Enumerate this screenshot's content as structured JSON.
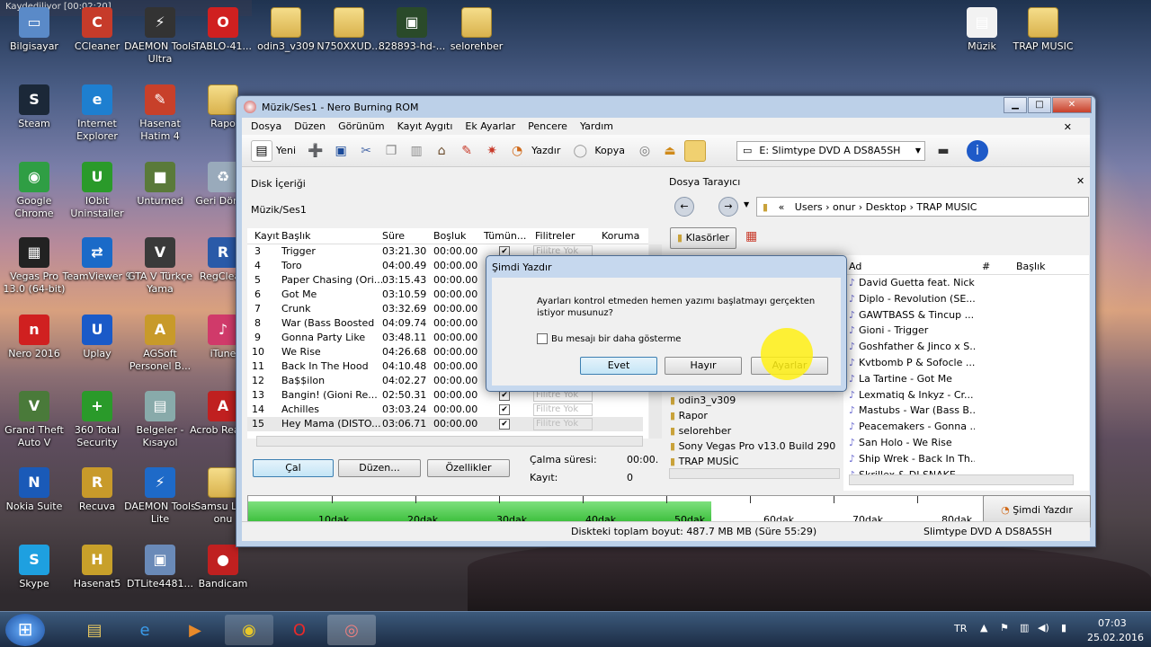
{
  "recording_label": "Kaydediliyor [00:02:20]",
  "desktop_icons": [
    {
      "label": "Bilgisayar",
      "glyph": "▭",
      "color": "#5a8ac8"
    },
    {
      "label": "CCleaner",
      "glyph": "C",
      "color": "#c63b2a"
    },
    {
      "label": "DAEMON Tools Ultra",
      "glyph": "⚡",
      "color": "#333"
    },
    {
      "label": "TABLO-41...",
      "glyph": "O",
      "color": "#d02020"
    },
    {
      "label": "odin3_v309",
      "glyph": "",
      "color": ""
    },
    {
      "label": "N750XXUD...",
      "glyph": "",
      "color": ""
    },
    {
      "label": "828893-hd-...",
      "glyph": "▣",
      "color": "#2a4a2a"
    },
    {
      "label": "selorehber",
      "glyph": "",
      "color": ""
    },
    {
      "label": "Müzik",
      "glyph": "▤",
      "color": "#f2f2f2"
    },
    {
      "label": "TRAP MUSIC",
      "glyph": "",
      "color": ""
    },
    {
      "label": "Steam",
      "glyph": "S",
      "color": "#1b2838"
    },
    {
      "label": "Internet Explorer",
      "glyph": "e",
      "color": "#1e7fd0"
    },
    {
      "label": "Hasenat Hatim 4",
      "glyph": "✎",
      "color": "#c8402a"
    },
    {
      "label": "Rapo",
      "glyph": "",
      "color": ""
    },
    {
      "label": "Google Chrome",
      "glyph": "◉",
      "color": "#2f9e44"
    },
    {
      "label": "IObit Uninstaller",
      "glyph": "U",
      "color": "#2a9a2a"
    },
    {
      "label": "Unturned",
      "glyph": "■",
      "color": "#5a7a3a"
    },
    {
      "label": "Geri Dönüş",
      "glyph": "♻",
      "color": "#9ab"
    },
    {
      "label": "Vegas Pro 13.0 (64-bit)",
      "glyph": "▦",
      "color": "#222"
    },
    {
      "label": "TeamViewer 9",
      "glyph": "⇄",
      "color": "#1a6ac8"
    },
    {
      "label": "GTA V Türkçe Yama",
      "glyph": "V",
      "color": "#3a3a3a"
    },
    {
      "label": "RegClean",
      "glyph": "R",
      "color": "#2a5aa8"
    },
    {
      "label": "Nero 2016",
      "glyph": "n",
      "color": "#d02020"
    },
    {
      "label": "Uplay",
      "glyph": "U",
      "color": "#1a5ac8"
    },
    {
      "label": "AGSoft Personel B...",
      "glyph": "A",
      "color": "#c89a2a"
    },
    {
      "label": "iTune",
      "glyph": "♪",
      "color": "#d03a6a"
    },
    {
      "label": "Grand Theft Auto V",
      "glyph": "V",
      "color": "#4a7a3a"
    },
    {
      "label": "360 Total Security",
      "glyph": "+",
      "color": "#2a9a2a"
    },
    {
      "label": "Belgeler - Kısayol",
      "glyph": "▤",
      "color": "#8aa"
    },
    {
      "label": "Acrob Reader",
      "glyph": "A",
      "color": "#c02020"
    },
    {
      "label": "Nokia Suite",
      "glyph": "N",
      "color": "#1a5ab8"
    },
    {
      "label": "Recuva",
      "glyph": "R",
      "color": "#c89a2a"
    },
    {
      "label": "DAEMON Tools Lite",
      "glyph": "⚡",
      "color": "#1e6ac8"
    },
    {
      "label": "Samsu Link onu",
      "glyph": "",
      "color": ""
    },
    {
      "label": "Skype",
      "glyph": "S",
      "color": "#1ea0e0"
    },
    {
      "label": "Hasenat5",
      "glyph": "H",
      "color": "#c8a02a"
    },
    {
      "label": "DTLite4481...",
      "glyph": "▣",
      "color": "#6a8ab8"
    },
    {
      "label": "Bandicam",
      "glyph": "●",
      "color": "#c02020"
    }
  ],
  "window": {
    "title": "Müzik/Ses1 - Nero Burning ROM",
    "menu": [
      "Dosya",
      "Düzen",
      "Görünüm",
      "Kayıt Aygıtı",
      "Ek Ayarlar",
      "Pencere",
      "Yardım"
    ],
    "toolbar": {
      "new": "Yeni",
      "burn": "Yazdır",
      "copy": "Kopya",
      "drive": "E: Slimtype DVD A DS8A5SH"
    },
    "left_panel": {
      "title": "Disk İçeriği",
      "compilation": "Müzik/Ses1",
      "columns": [
        "Kayıt",
        "Başlık",
        "Süre",
        "Boşluk",
        "Tümün...",
        "Filitreler",
        "Koruma"
      ],
      "filter_placeholder": "Filitre Yok",
      "tracks": [
        {
          "n": "3",
          "title": "Trigger",
          "dur": "03:21.30",
          "gap": "00:00.00"
        },
        {
          "n": "4",
          "title": "Toro",
          "dur": "04:00.49",
          "gap": "00:00.00"
        },
        {
          "n": "5",
          "title": "Paper Chasing (Ori...",
          "dur": "03:15.43",
          "gap": "00:00.00"
        },
        {
          "n": "6",
          "title": "Got Me",
          "dur": "03:10.59",
          "gap": "00:00.00"
        },
        {
          "n": "7",
          "title": "Crunk",
          "dur": "03:32.69",
          "gap": "00:00.00"
        },
        {
          "n": "8",
          "title": "War (Bass Boosted",
          "dur": "04:09.74",
          "gap": "00:00.00"
        },
        {
          "n": "9",
          "title": "Gonna Party Like",
          "dur": "03:48.11",
          "gap": "00:00.00"
        },
        {
          "n": "10",
          "title": "We Rise",
          "dur": "04:26.68",
          "gap": "00:00.00"
        },
        {
          "n": "11",
          "title": "Back In The Hood",
          "dur": "04:10.48",
          "gap": "00:00.00"
        },
        {
          "n": "12",
          "title": "Ba$$ilon",
          "dur": "04:02.27",
          "gap": "00:00.00"
        },
        {
          "n": "13",
          "title": "Bangin! (Gioni Re...",
          "dur": "02:50.31",
          "gap": "00:00.00"
        },
        {
          "n": "14",
          "title": "Achilles",
          "dur": "03:03.24",
          "gap": "00:00.00"
        },
        {
          "n": "15",
          "title": "Hey Mama (DISTO...",
          "dur": "03:06.71",
          "gap": "00:00.00"
        }
      ],
      "play_btn": "Çal",
      "edit_btn": "Düzen...",
      "props_btn": "Özellikler",
      "play_time_label": "Çalma süresi:",
      "play_time_value": "00:00.",
      "track_label": "Kayıt:",
      "track_value": "0"
    },
    "right_panel": {
      "title": "Dosya Tarayıcı",
      "path": [
        "«",
        "Users",
        "onur",
        "Desktop",
        "TRAP MUSIC"
      ],
      "folders_btn": "Klasörler",
      "columns": [
        "Ad",
        "#",
        "Başlık"
      ],
      "folders": [
        "odin3_v309",
        "Rapor",
        "selorehber",
        "Sony Vegas Pro v13.0 Build 290",
        "TRAP MUSİC"
      ],
      "files": [
        "David Guetta feat. Nick...",
        "Diplo - Revolution (SE...",
        "GAWTBASS & Tincup ...",
        "Gioni - Trigger",
        "Goshfather & Jinco x S...",
        "Kvtbomb P & Sofocle ...",
        "La Tartine - Got Me",
        "Lexmatiq & Inkyz - Cr...",
        "Mastubs - War (Bass B...",
        "Peacemakers - Gonna ...",
        "San Holo - We Rise",
        "Ship Wrek - Back In Th...",
        "Skrillex & DJ SNAKE ..."
      ]
    },
    "capacity": {
      "ticks": [
        "10dak",
        "20dak",
        "30dak",
        "40dak",
        "50dak",
        "60dak",
        "70dak",
        "80dak"
      ],
      "fill_fraction": 0.55,
      "burn_now": "Şimdi Yazdır"
    },
    "status": {
      "total": "Diskteki toplam boyut: 487.7 MB MB (Süre 55:29)",
      "drive": "Slimtype DVD A DS8A5SH"
    }
  },
  "dialog": {
    "title": "Şimdi Yazdır",
    "message": "Ayarları kontrol etmeden hemen yazımı başlatmayı gerçekten istiyor musunuz?",
    "checkbox": "Bu mesajı bir daha gösterme",
    "yes": "Evet",
    "no": "Hayır",
    "settings": "Ayarlar"
  },
  "tray": {
    "lang": "TR",
    "time": "07:03",
    "date": "25.02.2016"
  }
}
